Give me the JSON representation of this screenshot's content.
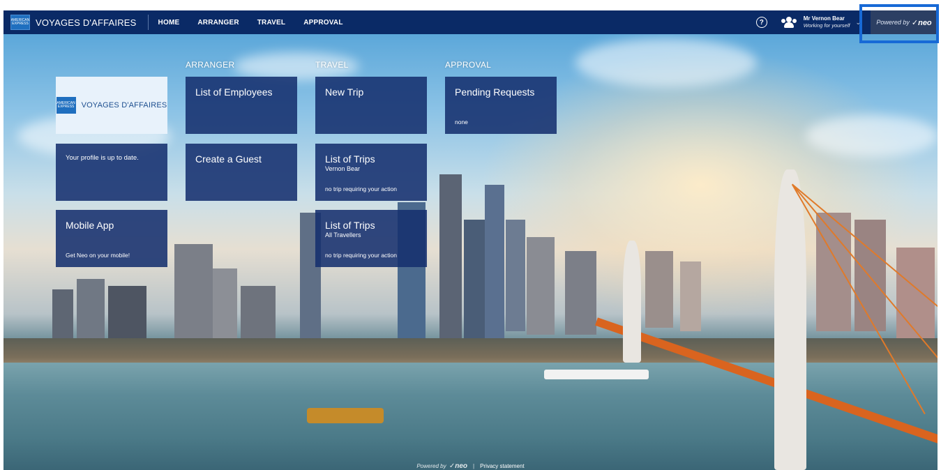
{
  "brand": {
    "name": "VOYAGES D'AFFAIRES",
    "logo_text": "AMERICAN EXPRESS"
  },
  "nav": {
    "items": [
      {
        "label": "HOME"
      },
      {
        "label": "ARRANGER"
      },
      {
        "label": "TRAVEL"
      },
      {
        "label": "APPROVAL"
      }
    ]
  },
  "user": {
    "name": "Mr Vernon Bear",
    "subtitle": "Working for yourself"
  },
  "powered_by": {
    "prefix": "Powered by",
    "brand": "neo"
  },
  "sections": {
    "arranger": "ARRANGER",
    "travel": "TRAVEL",
    "approval": "APPROVAL"
  },
  "tiles": {
    "logo": {
      "text": "VOYAGES D'AFFAIRES"
    },
    "profile": {
      "text": "Your profile is up to date."
    },
    "mobile": {
      "title": "Mobile App",
      "footer": "Get Neo on your mobile!"
    },
    "employees": {
      "title": "List of Employees"
    },
    "guest": {
      "title": "Create a Guest"
    },
    "new_trip": {
      "title": "New Trip"
    },
    "trips_mine": {
      "title": "List of Trips",
      "subtitle": "Vernon Bear",
      "footer": "no trip requiring your action"
    },
    "trips_all": {
      "title": "List of Trips",
      "subtitle": "All Travellers",
      "footer": "no trip requiring your action"
    },
    "pending": {
      "title": "Pending Requests",
      "footer": "none"
    }
  },
  "footer": {
    "powered_prefix": "Powered by",
    "powered_brand": "neo",
    "separator": "|",
    "privacy": "Privacy statement"
  },
  "colors": {
    "nav_bg": "#0a2a66",
    "tile_bg": "#16306e",
    "highlight": "#1769d6"
  }
}
